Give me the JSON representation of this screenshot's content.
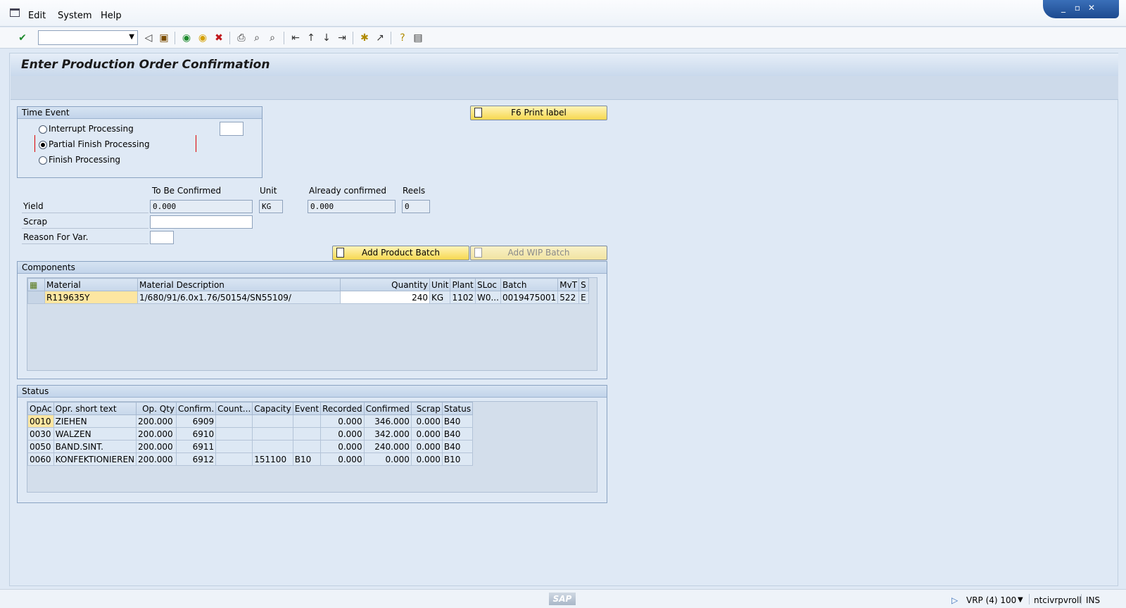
{
  "menu": {
    "edit": "Edit",
    "system": "System",
    "help": "Help"
  },
  "window_controls": {
    "minimize": "_",
    "restore": "▫",
    "close": "✕"
  },
  "title": "Enter Production Order Confirmation",
  "time_event": {
    "header": "Time Event",
    "options": [
      "Interrupt Processing",
      "Partial Finish Processing",
      "Finish Processing"
    ],
    "selected": "Partial Finish Processing"
  },
  "buttons": {
    "print_label": "F6 Print label",
    "add_product_batch": "Add Product Batch",
    "add_wip_batch": "Add WIP Batch"
  },
  "confirmation": {
    "col_to_be_confirmed": "To Be Confirmed",
    "col_unit": "Unit",
    "col_already_confirmed": "Already confirmed",
    "col_reels": "Reels",
    "yield_label": "Yield",
    "scrap_label": "Scrap",
    "reason_label": "Reason For Var.",
    "yield_value": "0.000",
    "unit_value": "KG",
    "already_confirmed_value": "0.000",
    "reels_value": "0",
    "scrap_value": "",
    "reason_value": ""
  },
  "components": {
    "header": "Components",
    "columns": [
      "Material",
      "Material Description",
      "Quantity",
      "Unit",
      "Plant",
      "SLoc",
      "Batch",
      "MvT",
      "S"
    ],
    "rows": [
      [
        "R119635Y",
        "1/680/91/6.0x1.76/50154/SN55109/",
        "240",
        "KG",
        "1102",
        "W0...",
        "0019475001",
        "522",
        "E"
      ]
    ]
  },
  "status": {
    "header": "Status",
    "columns": [
      "OpAc",
      "Opr. short text",
      "Op. Qty",
      "Confirm.",
      "Count...",
      "Capacity",
      "Event",
      "Recorded",
      "Confirmed",
      "Scrap",
      "Status"
    ],
    "rows": [
      [
        "0010",
        "ZIEHEN",
        "200.000",
        "6909",
        "",
        "",
        "",
        "0.000",
        "346.000",
        "0.000",
        "B40"
      ],
      [
        "0030",
        "WALZEN",
        "200.000",
        "6910",
        "",
        "",
        "",
        "0.000",
        "342.000",
        "0.000",
        "B40"
      ],
      [
        "0050",
        "BAND.SINT.",
        "200.000",
        "6911",
        "",
        "",
        "",
        "0.000",
        "240.000",
        "0.000",
        "B40"
      ],
      [
        "0060",
        "KONFEKTIONIEREN",
        "200.000",
        "6912",
        "",
        "151100",
        "B10",
        "0.000",
        "0.000",
        "0.000",
        "B10"
      ]
    ]
  },
  "statusbar": {
    "logo": "SAP",
    "system": "VRP (4) 100",
    "server": "ntcivrpvroll",
    "mode": "INS"
  },
  "icons": [
    "menu-icon",
    "enter-check-icon",
    "back-icon",
    "save-icon",
    "back-green-icon",
    "exit-icon",
    "cancel-icon",
    "print-icon",
    "find-icon",
    "find-next-icon",
    "first-page-icon",
    "previous-page-icon",
    "next-page-icon",
    "last-page-icon",
    "create-session-icon",
    "shortcut-icon",
    "help-icon",
    "layout-icon"
  ]
}
